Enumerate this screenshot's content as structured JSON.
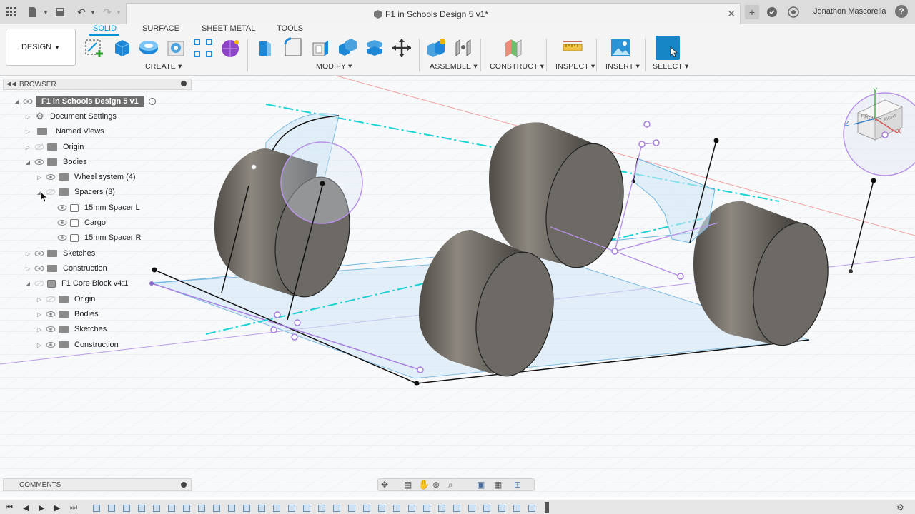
{
  "titlebar": {
    "document_title": "F1 in Schools Design 5 v1*",
    "user_name": "Jonathon Mascorella",
    "help_label": "?"
  },
  "toolbar": {
    "workspace": "DESIGN",
    "tabs": [
      "SOLID",
      "SURFACE",
      "SHEET METAL",
      "TOOLS"
    ],
    "active_tab": "SOLID",
    "groups": [
      "CREATE",
      "MODIFY",
      "ASSEMBLE",
      "CONSTRUCT",
      "INSPECT",
      "INSERT",
      "SELECT"
    ]
  },
  "browser": {
    "header": "BROWSER",
    "root": "F1 in Schools Design 5 v1",
    "items": [
      {
        "label": "Document Settings"
      },
      {
        "label": "Named Views"
      },
      {
        "label": "Origin"
      },
      {
        "label": "Bodies"
      },
      {
        "label": "Wheel system (4)"
      },
      {
        "label": "Spacers (3)"
      },
      {
        "label": "15mm Spacer L"
      },
      {
        "label": "Cargo"
      },
      {
        "label": "15mm Spacer R"
      },
      {
        "label": "Sketches"
      },
      {
        "label": "Construction"
      },
      {
        "label": "F1 Core Block v4:1"
      },
      {
        "label": "Origin"
      },
      {
        "label": "Bodies"
      },
      {
        "label": "Sketches"
      },
      {
        "label": "Construction"
      }
    ]
  },
  "comments": {
    "header": "COMMENTS"
  },
  "viewcube": {
    "front": "FRONT",
    "side": "RIGHT",
    "axis_z": "Z",
    "axis_x": "X",
    "axis_y": "Y"
  },
  "colors": {
    "accent": "#0696d7",
    "selection": "#9b6fd6",
    "construction_line": "#19d3d3"
  }
}
